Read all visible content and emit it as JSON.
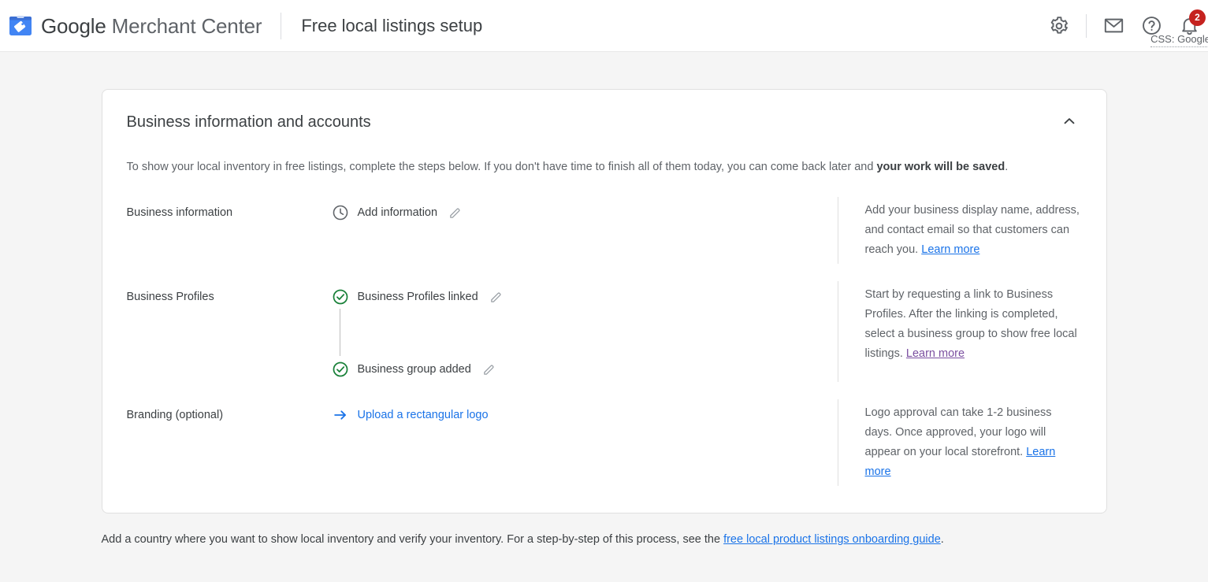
{
  "header": {
    "brand_google": "Google",
    "brand_rest": " Merchant Center",
    "page_title": "Free local listings setup",
    "icons": {
      "settings": "gear-icon",
      "mail": "mail-icon",
      "help": "help-icon",
      "notifications": "bell-icon"
    },
    "notification_count": "2",
    "css_label": "CSS: Google"
  },
  "card": {
    "title": "Business information and accounts",
    "collapse_icon": "chevron-up-icon",
    "subtitle_part1": "To show your local inventory in free listings, complete the steps below. If you don't have time to finish all of them today, you can come back later and ",
    "subtitle_bold": "your work will be saved",
    "subtitle_part2": ".",
    "rows": [
      {
        "label": "Business information",
        "tasks": [
          {
            "status": "pending",
            "text": "Add information",
            "edit": true,
            "link": false
          }
        ],
        "desc_text": "Add your business display name, address, and contact email so that customers can reach you. ",
        "desc_link": "Learn more",
        "link_visited": false
      },
      {
        "label": "Business Profiles",
        "tasks": [
          {
            "status": "done",
            "text": "Business Profiles linked",
            "edit": true,
            "link": false
          },
          {
            "status": "done",
            "text": "Business group added",
            "edit": true,
            "link": false
          }
        ],
        "desc_text": "Start by requesting a link to Business Profiles. After the linking is completed, select a business group to show free local listings. ",
        "desc_link": "Learn more",
        "link_visited": true
      },
      {
        "label": "Branding (optional)",
        "tasks": [
          {
            "status": "arrow",
            "text": "Upload a rectangular logo",
            "edit": false,
            "link": true
          }
        ],
        "desc_text": "Logo approval can take 1-2 business days. Once approved, your logo will appear on your local storefront. ",
        "desc_link": "Learn more",
        "link_visited": false
      }
    ]
  },
  "footnote": {
    "text_before": "Add a country where you want to show local inventory and verify your inventory. For a step-by-step of this process, see the ",
    "link": "free local product listings onboarding guide",
    "text_after": "."
  },
  "colors": {
    "accent_blue": "#1a73e8",
    "success_green": "#188038",
    "badge_red": "#c5221f",
    "page_bg": "#f5f5f5"
  }
}
